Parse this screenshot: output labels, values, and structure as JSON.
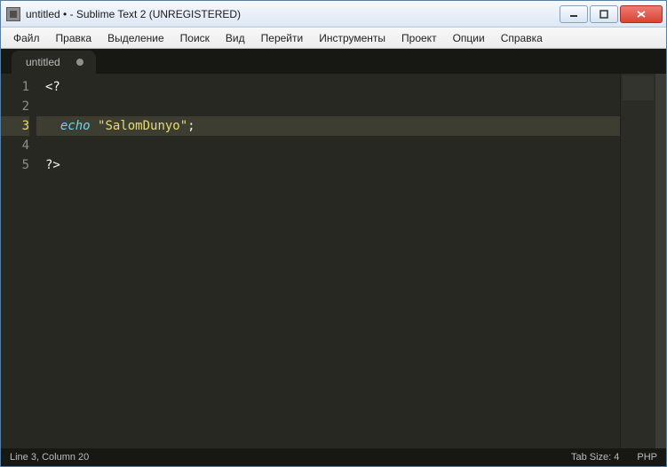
{
  "window": {
    "title": "untitled • - Sublime Text 2 (UNREGISTERED)"
  },
  "menu": {
    "items": [
      "Файл",
      "Правка",
      "Выделение",
      "Поиск",
      "Вид",
      "Перейти",
      "Инструменты",
      "Проект",
      "Опции",
      "Справка"
    ]
  },
  "tabs": [
    {
      "label": "untitled",
      "dirty": true
    }
  ],
  "editor": {
    "current_line_index": 2,
    "lines": [
      {
        "num": "1",
        "tokens": [
          {
            "t": "<?",
            "c": "delim"
          }
        ]
      },
      {
        "num": "2",
        "tokens": []
      },
      {
        "num": "3",
        "tokens": [
          {
            "t": "  ",
            "c": "plain"
          },
          {
            "t": "echo",
            "c": "keyword"
          },
          {
            "t": " ",
            "c": "plain"
          },
          {
            "t": "\"SalomDunyo\"",
            "c": "string"
          },
          {
            "t": ";",
            "c": "delim"
          }
        ]
      },
      {
        "num": "4",
        "tokens": []
      },
      {
        "num": "5",
        "tokens": [
          {
            "t": "?>",
            "c": "delim"
          }
        ]
      }
    ]
  },
  "status": {
    "position": "Line 3, Column 20",
    "tab_size": "Tab Size: 4",
    "syntax": "PHP"
  }
}
